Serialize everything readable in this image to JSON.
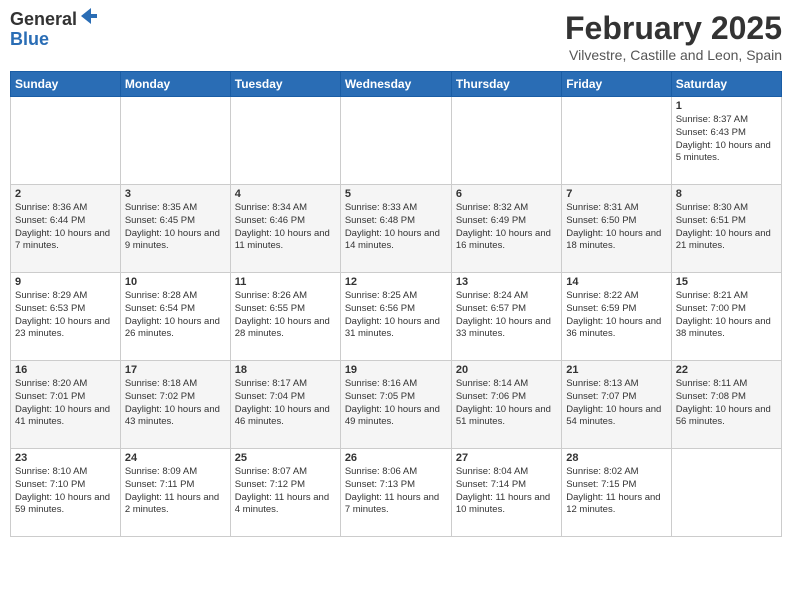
{
  "logo": {
    "general": "General",
    "blue": "Blue"
  },
  "header": {
    "month": "February 2025",
    "location": "Vilvestre, Castille and Leon, Spain"
  },
  "weekdays": [
    "Sunday",
    "Monday",
    "Tuesday",
    "Wednesday",
    "Thursday",
    "Friday",
    "Saturday"
  ],
  "weeks": [
    [
      {
        "day": "",
        "info": ""
      },
      {
        "day": "",
        "info": ""
      },
      {
        "day": "",
        "info": ""
      },
      {
        "day": "",
        "info": ""
      },
      {
        "day": "",
        "info": ""
      },
      {
        "day": "",
        "info": ""
      },
      {
        "day": "1",
        "info": "Sunrise: 8:37 AM\nSunset: 6:43 PM\nDaylight: 10 hours and 5 minutes."
      }
    ],
    [
      {
        "day": "2",
        "info": "Sunrise: 8:36 AM\nSunset: 6:44 PM\nDaylight: 10 hours and 7 minutes."
      },
      {
        "day": "3",
        "info": "Sunrise: 8:35 AM\nSunset: 6:45 PM\nDaylight: 10 hours and 9 minutes."
      },
      {
        "day": "4",
        "info": "Sunrise: 8:34 AM\nSunset: 6:46 PM\nDaylight: 10 hours and 11 minutes."
      },
      {
        "day": "5",
        "info": "Sunrise: 8:33 AM\nSunset: 6:48 PM\nDaylight: 10 hours and 14 minutes."
      },
      {
        "day": "6",
        "info": "Sunrise: 8:32 AM\nSunset: 6:49 PM\nDaylight: 10 hours and 16 minutes."
      },
      {
        "day": "7",
        "info": "Sunrise: 8:31 AM\nSunset: 6:50 PM\nDaylight: 10 hours and 18 minutes."
      },
      {
        "day": "8",
        "info": "Sunrise: 8:30 AM\nSunset: 6:51 PM\nDaylight: 10 hours and 21 minutes."
      }
    ],
    [
      {
        "day": "9",
        "info": "Sunrise: 8:29 AM\nSunset: 6:53 PM\nDaylight: 10 hours and 23 minutes."
      },
      {
        "day": "10",
        "info": "Sunrise: 8:28 AM\nSunset: 6:54 PM\nDaylight: 10 hours and 26 minutes."
      },
      {
        "day": "11",
        "info": "Sunrise: 8:26 AM\nSunset: 6:55 PM\nDaylight: 10 hours and 28 minutes."
      },
      {
        "day": "12",
        "info": "Sunrise: 8:25 AM\nSunset: 6:56 PM\nDaylight: 10 hours and 31 minutes."
      },
      {
        "day": "13",
        "info": "Sunrise: 8:24 AM\nSunset: 6:57 PM\nDaylight: 10 hours and 33 minutes."
      },
      {
        "day": "14",
        "info": "Sunrise: 8:22 AM\nSunset: 6:59 PM\nDaylight: 10 hours and 36 minutes."
      },
      {
        "day": "15",
        "info": "Sunrise: 8:21 AM\nSunset: 7:00 PM\nDaylight: 10 hours and 38 minutes."
      }
    ],
    [
      {
        "day": "16",
        "info": "Sunrise: 8:20 AM\nSunset: 7:01 PM\nDaylight: 10 hours and 41 minutes."
      },
      {
        "day": "17",
        "info": "Sunrise: 8:18 AM\nSunset: 7:02 PM\nDaylight: 10 hours and 43 minutes."
      },
      {
        "day": "18",
        "info": "Sunrise: 8:17 AM\nSunset: 7:04 PM\nDaylight: 10 hours and 46 minutes."
      },
      {
        "day": "19",
        "info": "Sunrise: 8:16 AM\nSunset: 7:05 PM\nDaylight: 10 hours and 49 minutes."
      },
      {
        "day": "20",
        "info": "Sunrise: 8:14 AM\nSunset: 7:06 PM\nDaylight: 10 hours and 51 minutes."
      },
      {
        "day": "21",
        "info": "Sunrise: 8:13 AM\nSunset: 7:07 PM\nDaylight: 10 hours and 54 minutes."
      },
      {
        "day": "22",
        "info": "Sunrise: 8:11 AM\nSunset: 7:08 PM\nDaylight: 10 hours and 56 minutes."
      }
    ],
    [
      {
        "day": "23",
        "info": "Sunrise: 8:10 AM\nSunset: 7:10 PM\nDaylight: 10 hours and 59 minutes."
      },
      {
        "day": "24",
        "info": "Sunrise: 8:09 AM\nSunset: 7:11 PM\nDaylight: 11 hours and 2 minutes."
      },
      {
        "day": "25",
        "info": "Sunrise: 8:07 AM\nSunset: 7:12 PM\nDaylight: 11 hours and 4 minutes."
      },
      {
        "day": "26",
        "info": "Sunrise: 8:06 AM\nSunset: 7:13 PM\nDaylight: 11 hours and 7 minutes."
      },
      {
        "day": "27",
        "info": "Sunrise: 8:04 AM\nSunset: 7:14 PM\nDaylight: 11 hours and 10 minutes."
      },
      {
        "day": "28",
        "info": "Sunrise: 8:02 AM\nSunset: 7:15 PM\nDaylight: 11 hours and 12 minutes."
      },
      {
        "day": "",
        "info": ""
      }
    ]
  ]
}
